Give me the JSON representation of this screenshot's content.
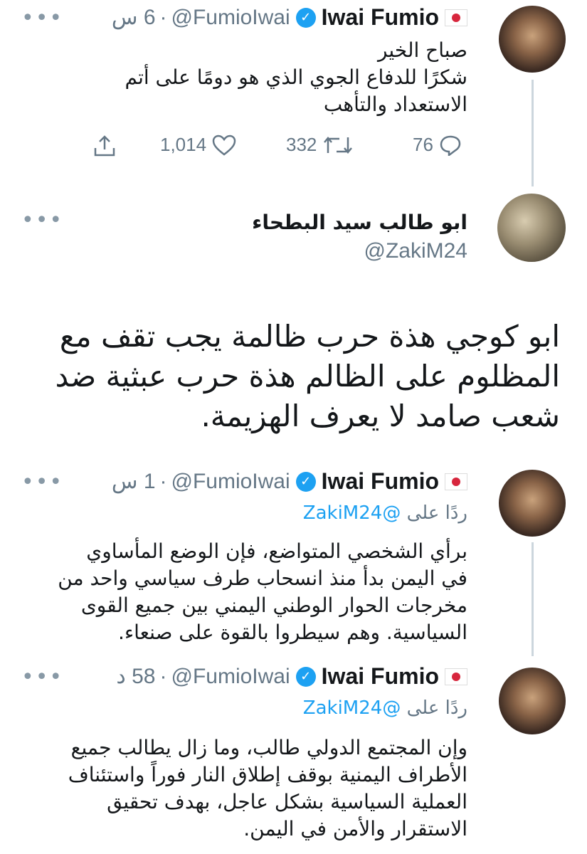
{
  "tweet1": {
    "name": "Iwai Fumio",
    "handle": "@FumioIwai",
    "time": "6 س",
    "text_lines": [
      "صباح الخير",
      "شكرًا للدفاع الجوي الذي هو دومًا على أتم",
      "الاستعداد والتأهب"
    ],
    "replies": "76",
    "retweets": "332",
    "likes": "1,014"
  },
  "main_tweet": {
    "name": "ابو طالب سيد البطحاء",
    "handle": "@ZakiM24",
    "text_lines": [
      "ابو كوجي هذة حرب ظالمة يجب تقف مع",
      "المظلوم على الظالم هذة حرب عبثية ضد",
      "شعب صامد لا يعرف الهزيمة."
    ]
  },
  "reply1": {
    "name": "Iwai Fumio",
    "handle": "@FumioIwai",
    "time": "1 س",
    "reply_prefix": "ردًا على",
    "reply_handle": "@ZakiM24",
    "text_lines": [
      "برأي الشخصي المتواضع، فإن الوضع المأساوي",
      "في اليمن بدأ منذ انسحاب طرف سياسي واحد من",
      "مخرجات الحوار الوطني اليمني بين جميع القوى",
      "السياسية. وهم سيطروا بالقوة على صنعاء."
    ]
  },
  "reply2": {
    "name": "Iwai Fumio",
    "handle": "@FumioIwai",
    "time": "58 د",
    "reply_prefix": "ردًا على",
    "reply_handle": "@ZakiM24",
    "text_lines": [
      "وإن المجتمع الدولي طالب، وما زال يطالب جميع",
      "الأطراف اليمنية بوقف إطلاق النار فوراً واستئناف",
      "العملية السياسية بشكل عاجل، بهدف تحقيق",
      "الاستقرار والأمن في اليمن."
    ]
  },
  "icons": {
    "more": "more-icon",
    "reply": "reply-icon",
    "retweet": "retweet-icon",
    "like": "like-icon",
    "share": "share-icon",
    "verified": "verified-badge-icon",
    "flag": "japan-flag-icon"
  },
  "colors": {
    "accent": "#1da1f2",
    "muted": "#657786",
    "text": "#14171a",
    "divider": "#ccd6dd"
  }
}
